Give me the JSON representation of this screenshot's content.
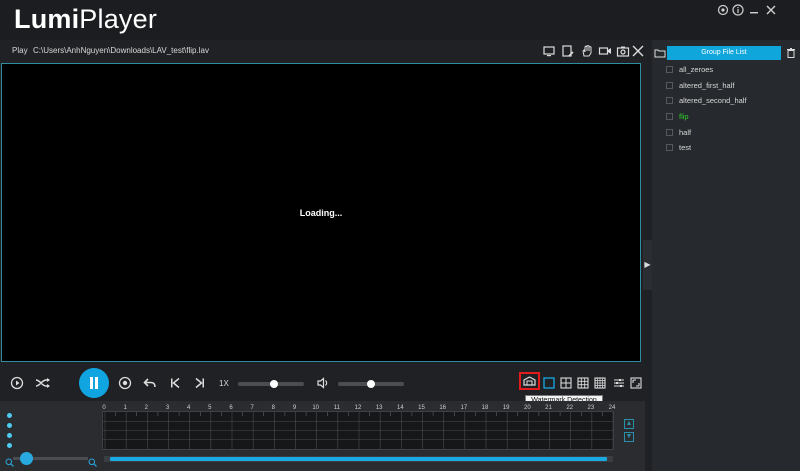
{
  "app": {
    "title_part1": "Lumi",
    "title_part2": "Player"
  },
  "pathbar": {
    "play_label": "Play",
    "file_path": "C:\\Users\\AnhNguyen\\Downloads\\LAV_test\\flip.lav"
  },
  "video": {
    "status_text": "Loading..."
  },
  "panel": {
    "header": "Group File List",
    "files": [
      {
        "name": "all_zeroes",
        "active": false
      },
      {
        "name": "altered_first_half",
        "active": false
      },
      {
        "name": "altered_second_half",
        "active": false
      },
      {
        "name": "flip",
        "active": true
      },
      {
        "name": "half",
        "active": false
      },
      {
        "name": "test",
        "active": false
      }
    ]
  },
  "controls": {
    "speed_label": "1X",
    "speed_level": 0.55,
    "volume_level": 0.5
  },
  "tooltip": {
    "text": "Watermark Detection"
  },
  "timeline": {
    "hours": [
      "0",
      "1",
      "2",
      "3",
      "4",
      "5",
      "6",
      "7",
      "8",
      "9",
      "10",
      "11",
      "12",
      "13",
      "14",
      "15",
      "16",
      "17",
      "18",
      "19",
      "20",
      "21",
      "22",
      "23",
      "24"
    ]
  },
  "colors": {
    "accent": "#10a5e0",
    "active_file": "#2ed12e",
    "highlight_border": "#e31b1b"
  },
  "icons": [
    "settings-icon",
    "info-icon",
    "minimize-icon",
    "close-icon",
    "monitor-icon",
    "edit-icon",
    "hand-icon",
    "record-icon",
    "camera-icon",
    "close-x-icon",
    "folder-icon",
    "trash-icon",
    "replay-icon",
    "shuffle-icon",
    "stop-icon",
    "undo-icon",
    "prev-icon",
    "next-icon",
    "volume-icon",
    "watermark-icon",
    "layout1-icon",
    "layout4-icon",
    "layout9-icon",
    "layout16-icon",
    "adjust-icon",
    "fullscreen-icon"
  ]
}
